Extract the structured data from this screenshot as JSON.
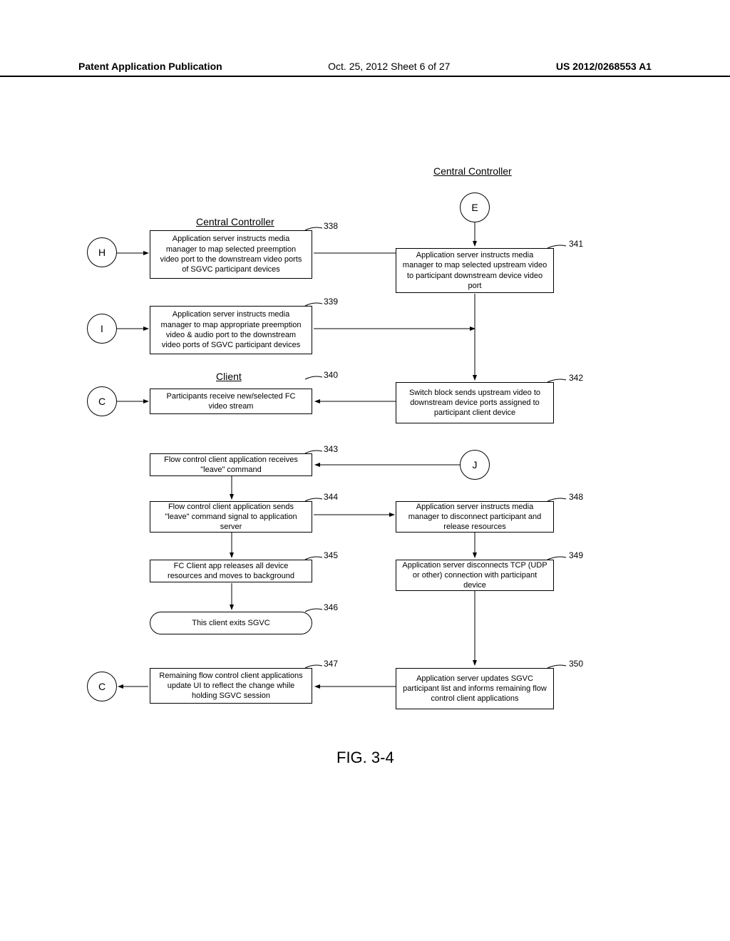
{
  "header": {
    "left": "Patent Application Publication",
    "center": "Oct. 25, 2012  Sheet 6 of 27",
    "right": "US 2012/0268553 A1"
  },
  "titles": {
    "controller_left": "Central Controller",
    "controller_right": "Central Controller",
    "client": "Client"
  },
  "connectors": {
    "H": "H",
    "I": "I",
    "C1": "C",
    "C2": "C",
    "E": "E",
    "J": "J"
  },
  "boxes": {
    "b338": "Application server instructs media manager to map selected preemption video port to the downstream video ports of SGVC participant devices",
    "b339": "Application server instructs media manager to map appropriate preemption video & audio port to the downstream video ports of SGVC participant devices",
    "b340": "Participants receive new/selected FC video stream",
    "b341": "Application server instructs media manager to map selected upstream video to participant downstream device video port",
    "b342": "Switch block sends upstream video to downstream device ports assigned to participant client device",
    "b343": "Flow control client application receives \"leave\" command",
    "b344": "Flow control client application sends \"leave\" command signal to application server",
    "b345": "FC Client app releases all device resources and moves to background",
    "b346": "This client exits SGVC",
    "b347": "Remaining flow control client applications update UI to reflect the change while holding SGVC session",
    "b348": "Application server instructs media manager to disconnect participant and release resources",
    "b349": "Application server disconnects TCP (UDP or other) connection with participant device",
    "b350": "Application server updates SGVC participant list and informs remaining flow control client applications"
  },
  "refs": {
    "r338": "338",
    "r339": "339",
    "r340": "340",
    "r341": "341",
    "r342": "342",
    "r343": "343",
    "r344": "344",
    "r345": "345",
    "r346": "346",
    "r347": "347",
    "r348": "348",
    "r349": "349",
    "r350": "350"
  },
  "figure_label": "FIG. 3-4"
}
